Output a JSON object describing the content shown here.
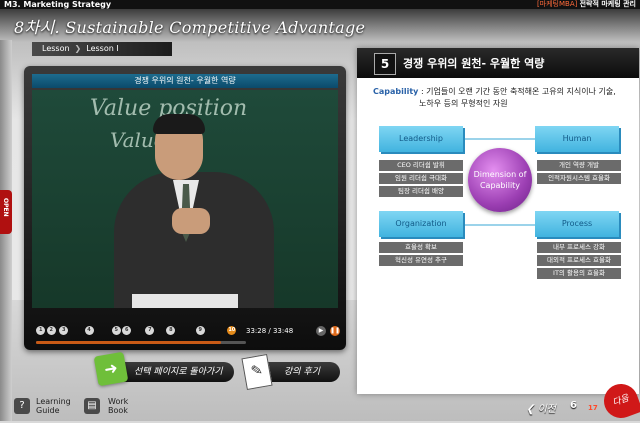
{
  "header": {
    "course": "M3. Marketing Strategy",
    "brand_tag": "[마케팅MBA]",
    "brand_text": "전략적 마케팅 관리",
    "lesson_title": "8차시. Sustainable Competitive Advantage",
    "crumb_lesson": "Lesson",
    "crumb_current": "Lesson I"
  },
  "side_tab": {
    "label": "OPEN"
  },
  "video": {
    "title": "경쟁 우위의 원천- 우월한 역량",
    "chalk_lines": [
      "Value position",
      "Value"
    ],
    "timecode": "33:28 / 33:48",
    "progress": 0.88,
    "markers": [
      {
        "label": "1",
        "pos": 0.02
      },
      {
        "label": "2",
        "pos": 0.07
      },
      {
        "label": "3",
        "pos": 0.13
      },
      {
        "label": "4",
        "pos": 0.25
      },
      {
        "label": "5",
        "pos": 0.38
      },
      {
        "label": "6",
        "pos": 0.43
      },
      {
        "label": "7",
        "pos": 0.54
      },
      {
        "label": "8",
        "pos": 0.64
      },
      {
        "label": "9",
        "pos": 0.78
      },
      {
        "label": "10",
        "pos": 0.93,
        "current": true
      }
    ]
  },
  "actions": {
    "back_to_start": "선택 페이지로 돌아가기",
    "lecture_notes": "강의 후기"
  },
  "footer": {
    "learning_guide": [
      "Learning",
      "Guide"
    ],
    "work_book": [
      "Work",
      "Book"
    ]
  },
  "slide": {
    "number": "5",
    "title": "경쟁 우위의 원천- 우월한 역량",
    "cap_key": "Capability",
    "cap_line1": ": 기업들이 오랜 기간 동안 축적해온 고유의 지식이나 기술,",
    "cap_line2": "노하우 등의 무형적인 자원",
    "center": [
      "Dimension of",
      "Capability"
    ],
    "leadership": {
      "label": "Leadership",
      "items": [
        "CEO 리더쉽 발휘",
        "임원 리더쉽 극대화",
        "팀장 리더쉽 배양"
      ]
    },
    "human": {
      "label": "Human",
      "items": [
        "개인 역량 개발",
        "인적자원시스템 효율화"
      ]
    },
    "organization": {
      "label": "Organization",
      "items": [
        "효율성 확보",
        "혁신성 유연성 추구"
      ]
    },
    "process": {
      "label": "Process",
      "items": [
        "내부 프로세스 강화",
        "대외적 프로세스 효율화",
        "IT의 활용의 효율화"
      ]
    }
  },
  "nav": {
    "prev": "이전",
    "page_current": "6",
    "page_total": "17",
    "next": "다음"
  },
  "colors": {
    "accent_blue": "#41b3df",
    "center_purple": "#9c3fb3",
    "progress_orange": "#c85a16",
    "next_red": "#d01818"
  }
}
